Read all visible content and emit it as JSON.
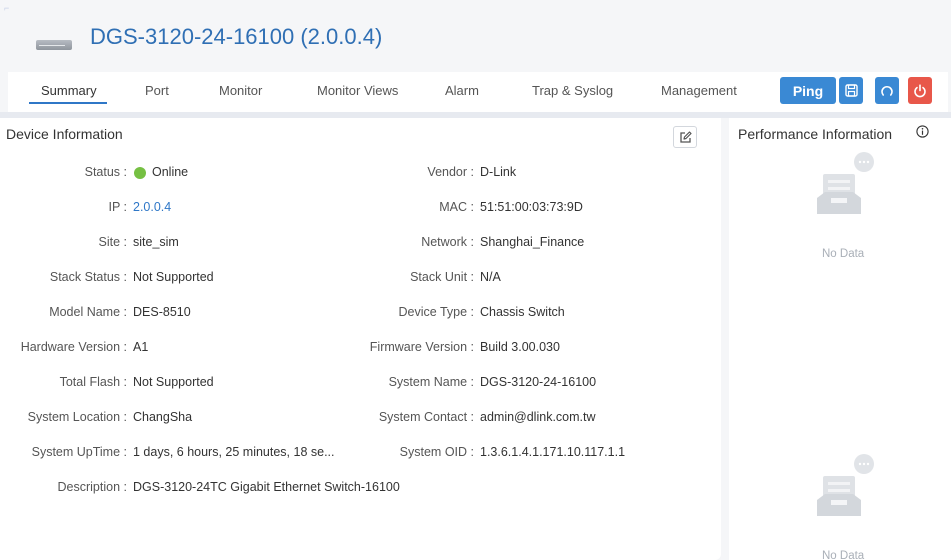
{
  "header": {
    "device_title": "DGS-3120-24-16100 (2.0.0.4)"
  },
  "tabs": [
    {
      "label": "Summary",
      "active": true
    },
    {
      "label": "Port"
    },
    {
      "label": "Monitor"
    },
    {
      "label": "Monitor Views"
    },
    {
      "label": "Alarm"
    },
    {
      "label": "Trap & Syslog"
    },
    {
      "label": "Management"
    }
  ],
  "toolbar": {
    "ping_label": "Ping"
  },
  "device_info": {
    "title": "Device Information",
    "left": [
      {
        "label": "Status :",
        "value": "Online"
      },
      {
        "label": "IP :",
        "value": "2.0.0.4"
      },
      {
        "label": "Site :",
        "value": "site_sim"
      },
      {
        "label": "Stack Status :",
        "value": "Not Supported"
      },
      {
        "label": "Model Name :",
        "value": "DES-8510"
      },
      {
        "label": "Hardware Version :",
        "value": "A1"
      },
      {
        "label": "Total Flash :",
        "value": "Not Supported"
      },
      {
        "label": "System Location :",
        "value": "ChangSha"
      },
      {
        "label": "System UpTime :",
        "value": "1 days, 6 hours, 25 minutes, 18 se..."
      },
      {
        "label": "Description :",
        "value": "DGS-3120-24TC Gigabit Ethernet Switch-16100"
      }
    ],
    "right": [
      {
        "label": "Vendor :",
        "value": "D-Link"
      },
      {
        "label": "MAC :",
        "value": "51:51:00:03:73:9D"
      },
      {
        "label": "Network :",
        "value": "Shanghai_Finance"
      },
      {
        "label": "Stack Unit :",
        "value": "N/A"
      },
      {
        "label": "Device Type :",
        "value": "Chassis Switch"
      },
      {
        "label": "Firmware Version :",
        "value": "Build 3.00.030"
      },
      {
        "label": "System Name :",
        "value": "DGS-3120-24-16100"
      },
      {
        "label": "System Contact :",
        "value": "admin@dlink.com.tw"
      },
      {
        "label": "System OID :",
        "value": "1.3.6.1.4.1.171.10.117.1.1"
      }
    ]
  },
  "performance": {
    "title": "Performance Information",
    "empty_states": [
      {
        "text": "No Data"
      },
      {
        "text": "No Data"
      }
    ]
  },
  "colors": {
    "accent": "#3a89d4",
    "title_blue": "#2f6fb4",
    "status_online": "#76c043",
    "power": "#e8574a"
  }
}
